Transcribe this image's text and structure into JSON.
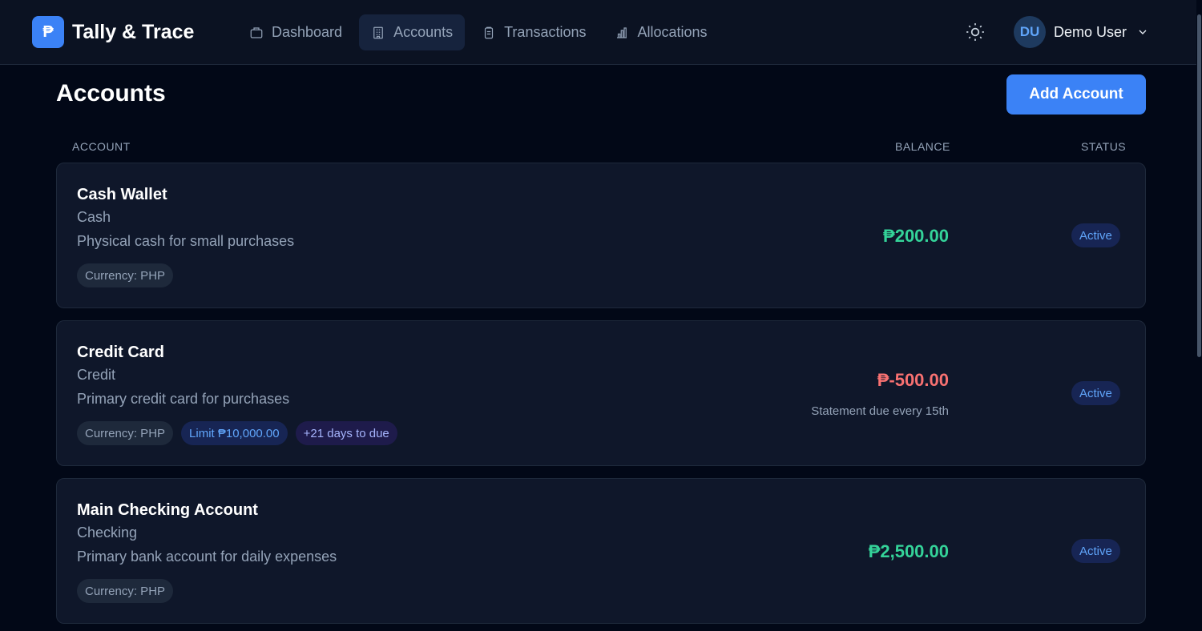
{
  "app": {
    "logo_glyph": "₱",
    "name": "Tally & Trace"
  },
  "nav": [
    {
      "label": "Dashboard",
      "icon": "wallet-icon",
      "active": false
    },
    {
      "label": "Accounts",
      "icon": "building-icon",
      "active": true
    },
    {
      "label": "Transactions",
      "icon": "clipboard-icon",
      "active": false
    },
    {
      "label": "Allocations",
      "icon": "bar-chart-icon",
      "active": false
    }
  ],
  "user": {
    "initials": "DU",
    "name": "Demo User"
  },
  "page": {
    "title": "Accounts",
    "add_button": "Add Account"
  },
  "columns": {
    "account": "ACCOUNT",
    "balance": "BALANCE",
    "status": "STATUS"
  },
  "accounts": [
    {
      "name": "Cash Wallet",
      "type": "Cash",
      "description": "Physical cash for small purchases",
      "tags": [
        "Currency: PHP"
      ],
      "balance": "₱200.00",
      "balance_note": "",
      "status": "Active"
    },
    {
      "name": "Credit Card",
      "type": "Credit",
      "description": "Primary credit card for purchases",
      "tags": [
        "Currency: PHP",
        "Limit ₱10,000.00",
        "+21 days to due"
      ],
      "balance": "₱-500.00",
      "balance_note": "Statement due every 15th",
      "status": "Active"
    },
    {
      "name": "Main Checking Account",
      "type": "Checking",
      "description": "Primary bank account for daily expenses",
      "tags": [
        "Currency: PHP"
      ],
      "balance": "₱2,500.00",
      "balance_note": "",
      "status": "Active"
    }
  ],
  "colors": {
    "accent": "#3b82f6",
    "positive": "#34d399",
    "negative": "#f87171",
    "background": "#020817"
  }
}
